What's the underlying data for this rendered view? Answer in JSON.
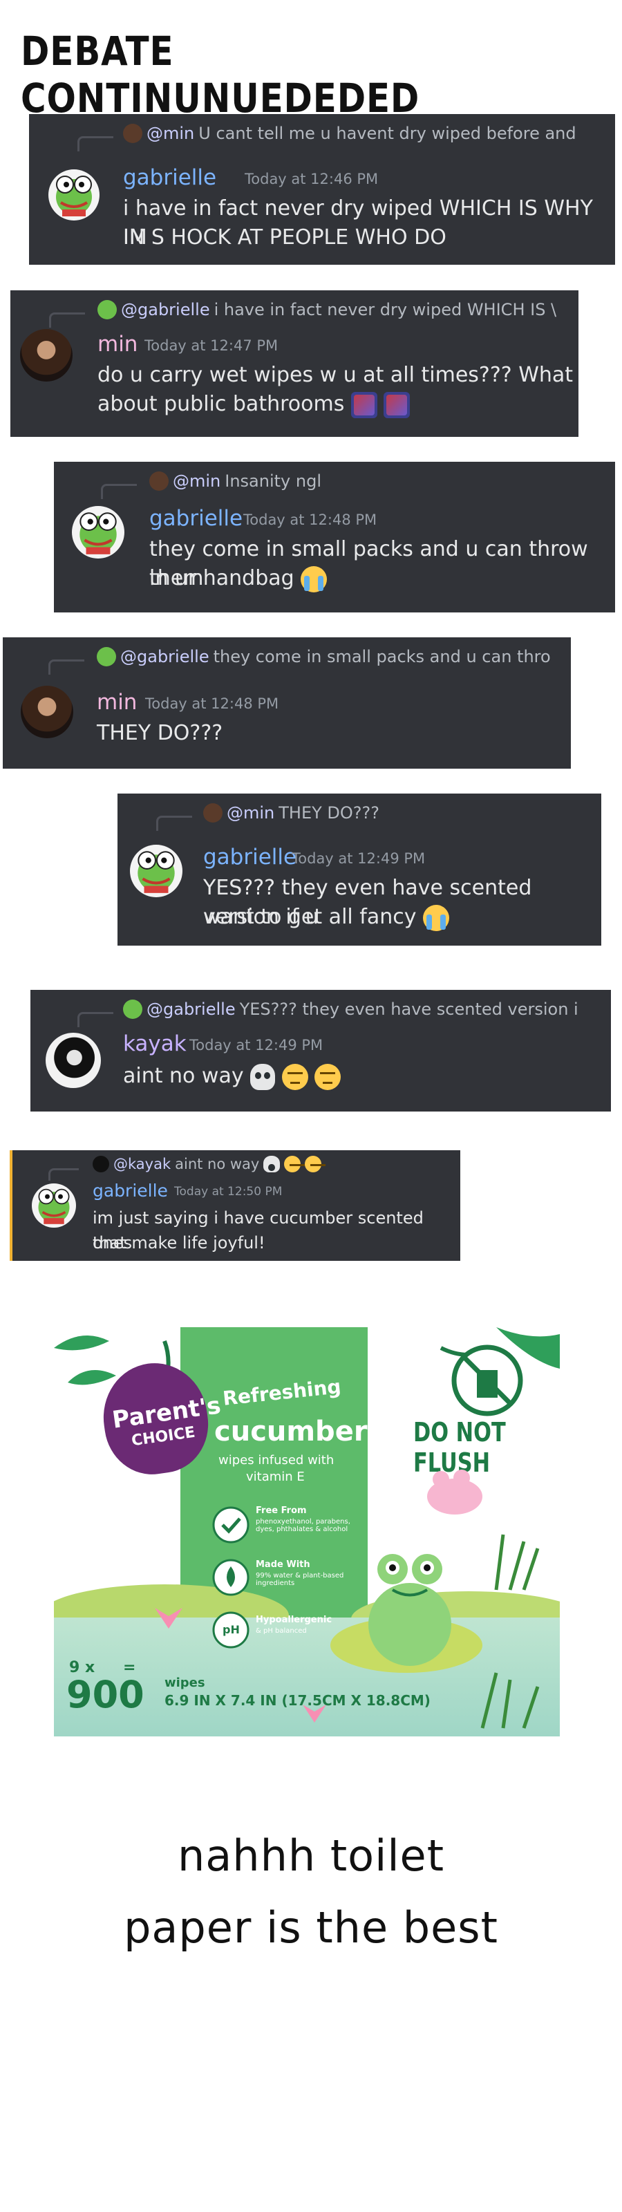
{
  "page_title": "DEBATE CONTINUNUEDEDED",
  "messages": [
    {
      "reply_to": "@min",
      "reply_text": "U cant tell me u havent dry wiped before and",
      "author": "gabrielle",
      "time": "Today at 12:46 PM",
      "lines": [
        "i have in fact never dry wiped WHICH IS WHY IM",
        "IN S HOCK AT PEOPLE WHO DO"
      ]
    },
    {
      "reply_to": "@gabrielle",
      "reply_text": "i have in fact never dry wiped WHICH IS \\",
      "author": "min",
      "time": "Today at 12:47 PM",
      "lines": [
        "do u carry wet wipes w u at all times??? What",
        "about public bathrooms"
      ]
    },
    {
      "reply_to": "@min",
      "reply_text": "Insanity ngl",
      "author": "gabrielle",
      "time": "Today at 12:48 PM",
      "lines": [
        "they come in small packs and u can throw them",
        "in ur handbag"
      ]
    },
    {
      "reply_to": "@gabrielle",
      "reply_text": "they come in small packs and u can thro",
      "author": "min",
      "time": "Today at 12:48 PM",
      "lines": [
        "THEY DO???"
      ]
    },
    {
      "reply_to": "@min",
      "reply_text": "THEY DO???",
      "author": "gabrielle",
      "time": "Today at 12:49 PM",
      "lines": [
        "YES??? they even have scented version if u",
        "want to get all fancy"
      ]
    },
    {
      "reply_to": "@gabrielle",
      "reply_text": "YES??? they even have scented version i",
      "author": "kayak",
      "time": "Today at 12:49 PM",
      "lines": [
        "aint no way"
      ]
    },
    {
      "reply_to": "@kayak",
      "reply_text": "aint no way",
      "author": "gabrielle",
      "time": "Today at 12:50 PM",
      "lines": [
        "im just saying i have cucumber scented ones",
        "that make life joyful!"
      ]
    }
  ],
  "product": {
    "brand_line1": "Parent's",
    "brand_line2": "CHOICE",
    "scent_top": "Refreshing",
    "scent": "cucumber",
    "infused_line1": "wipes infused with",
    "infused_line2": "vitamin E",
    "claim1_title": "Free From",
    "claim1_text": "phenoxyethanol, parabens, dyes, phthalates & alcohol",
    "claim2_title": "Made With",
    "claim2_text": "99% water & plant-based ingredients",
    "claim3_title": "Hypoallergenic",
    "claim3_text": "& pH balanced",
    "warning": "DO NOT FLUSH",
    "count_formula": "9 x",
    "count_eq": "=",
    "count": "900",
    "count_unit": "wipes",
    "size": "6.9 IN X 7.4 IN (17.5CM X 18.8CM)",
    "ph_label": "pH"
  },
  "closing_line1": "nahhh toilet",
  "closing_line2": "paper is the best",
  "colors": {
    "card_bg": "#313338",
    "gabrielle": "#7cb4ff",
    "min": "#f2b8de",
    "kayak": "#c8b2ff",
    "timestamp": "#949ba4",
    "product_green": "#5dbb6a",
    "brand_purple": "#6b2a74"
  }
}
